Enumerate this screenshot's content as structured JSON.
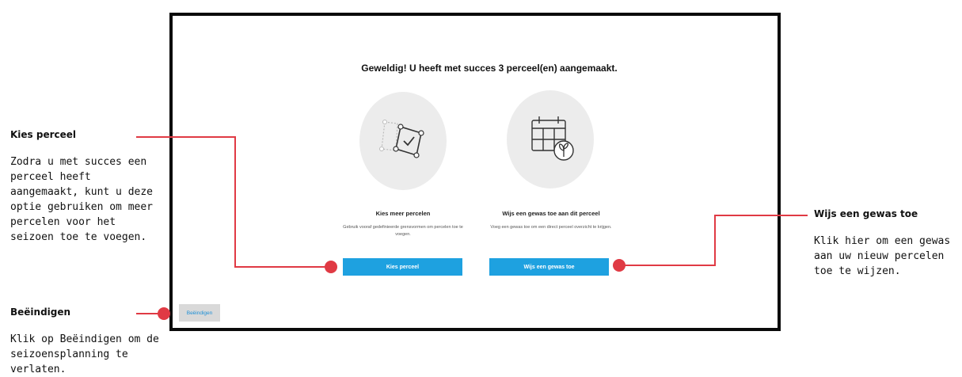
{
  "dialog": {
    "headline": "Geweldig! U heeft met succes 3 perceel(en) aangemaakt.",
    "option_plots": {
      "icon": "plot-selection-icon",
      "title": "Kies meer percelen",
      "description": "Gebruik vooraf gedefinieerde grensvormen om percelen toe te voegen.",
      "button_label": "Kies perceel"
    },
    "option_crop": {
      "icon": "calendar-plant-icon",
      "title": "Wijs een gewas toe aan dit perceel",
      "description": "Voeg een gewas toe om een direct perceel overzicht te krijgen.",
      "button_label": "Wijs een gewas toe"
    },
    "finish_button_label": "Beëindigen"
  },
  "annotations": {
    "kies_perceel": {
      "title": "Kies perceel",
      "text": "Zodra u met succes een perceel heeft aangemaakt, kunt u deze optie gebruiken om meer percelen voor het seizoen toe te voegen."
    },
    "beeindigen": {
      "title": "Beëindigen",
      "text": "Klik op Beëindigen om de seizoensplanning te verlaten."
    },
    "wijs_gewas": {
      "title": "Wijs een gewas toe",
      "text": "Klik hier om een gewas aan uw nieuw percelen toe te wijzen."
    }
  },
  "colors": {
    "accent_blue": "#1ea1e0",
    "callout_red": "#e03a44",
    "frame_border": "#0a0a0a",
    "icon_circle": "#ececec"
  }
}
